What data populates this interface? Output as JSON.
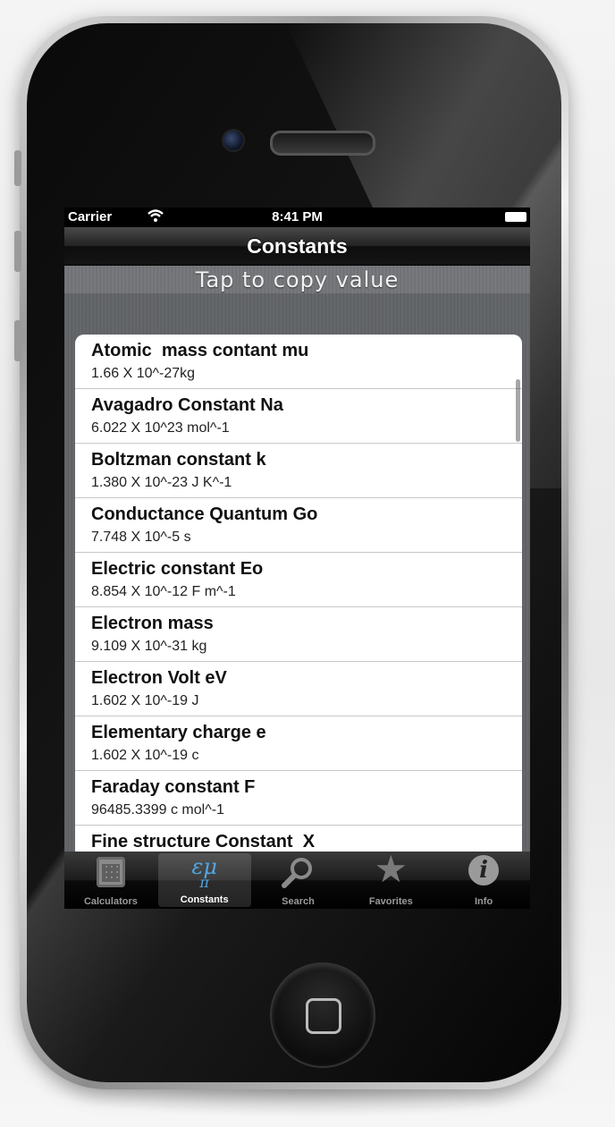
{
  "status_bar": {
    "carrier": "Carrier",
    "time": "8:41 PM"
  },
  "nav": {
    "title": "Constants"
  },
  "banner": {
    "text": "Tap to copy value"
  },
  "constants": [
    {
      "name": "Atomic  mass contant mu",
      "value": "1.66 X 10^-27kg"
    },
    {
      "name": "Avagadro Constant Na",
      "value": "6.022 X 10^23 mol^-1"
    },
    {
      "name": "Boltzman constant k",
      "value": "1.380 X 10^-23 J K^-1"
    },
    {
      "name": "Conductance Quantum Go",
      "value": "7.748 X 10^-5 s"
    },
    {
      "name": "Electric constant Eo",
      "value": "8.854 X 10^-12 F m^-1"
    },
    {
      "name": "Electron mass",
      "value": "9.109 X 10^-31 kg"
    },
    {
      "name": "Electron Volt eV",
      "value": "1.602 X 10^-19 J"
    },
    {
      "name": "Elementary charge e",
      "value": "1.602 X 10^-19 c"
    },
    {
      "name": "Faraday constant F",
      "value": "96485.3399 c mol^-1"
    },
    {
      "name": "Fine structure Constant  X",
      "value": ""
    }
  ],
  "tabs": [
    {
      "label": "Calculators",
      "icon": "calculator-icon",
      "active": false
    },
    {
      "label": "Constants",
      "icon": "constants-icon",
      "icon_text": "εμ",
      "icon_sub": "π",
      "active": true
    },
    {
      "label": "Search",
      "icon": "search-icon",
      "active": false
    },
    {
      "label": "Favorites",
      "icon": "star-icon",
      "active": false
    },
    {
      "label": "Info",
      "icon": "info-icon",
      "icon_text": "i",
      "active": false
    }
  ],
  "colors": {
    "active_icon": "#4fa8e8",
    "tab_label_inactive": "#9a9a9a"
  }
}
